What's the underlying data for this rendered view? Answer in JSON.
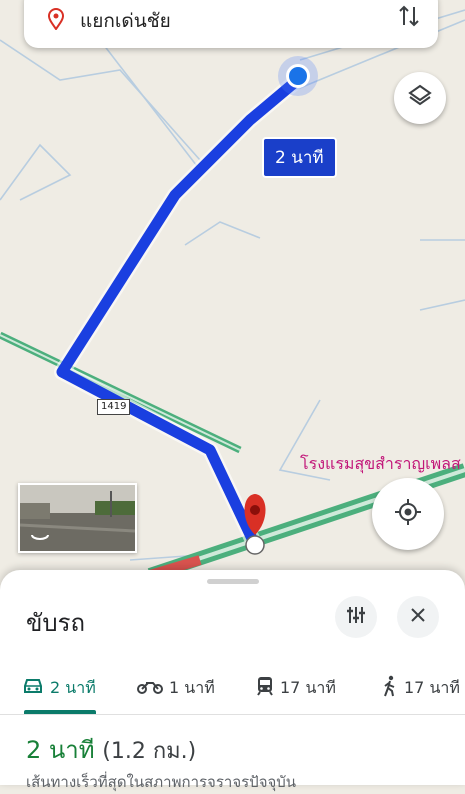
{
  "search": {
    "destination": "แยกเด่นชัย"
  },
  "map": {
    "route_time_label": "2 นาที",
    "road_number": "1419",
    "poi_label": "โรงแรมสุขสำราญเพลส",
    "route_color": "#1a3fe0",
    "highway_color": "#4caf7d"
  },
  "sheet": {
    "title": "ขับรถ",
    "tabs": [
      {
        "mode": "car-icon",
        "label": "2 นาที",
        "active": true
      },
      {
        "mode": "motorcycle-icon",
        "label": "1 นาที",
        "active": false
      },
      {
        "mode": "transit-icon",
        "label": "17 นาที",
        "active": false
      },
      {
        "mode": "walk-icon",
        "label": "17 นาที",
        "active": false
      }
    ],
    "route": {
      "time": "2 นาที",
      "distance": "(1.2 กม.)",
      "description": "เส้นทางเร็วที่สุดในสภาพการจราจรปัจจุบัน"
    }
  },
  "colors": {
    "accent": "#0b7b6a",
    "time_green": "#188038",
    "pin_red": "#d93025"
  }
}
